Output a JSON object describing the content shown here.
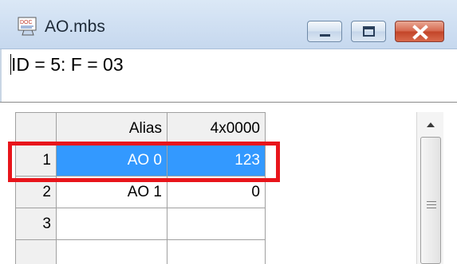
{
  "window": {
    "title": "AO.mbs",
    "icon": "doc-icon",
    "icon_label": "DOC",
    "controls": [
      "minimize",
      "maximize",
      "close"
    ]
  },
  "status": {
    "text": "ID = 5: F = 03"
  },
  "grid": {
    "columns": [
      "",
      "Alias",
      "4x0000"
    ],
    "rows": [
      {
        "row_num": "1",
        "alias": "AO 0",
        "value": "123",
        "selected": true
      },
      {
        "row_num": "2",
        "alias": "AO 1",
        "value": "0",
        "selected": false
      },
      {
        "row_num": "3",
        "alias": "",
        "value": "",
        "selected": false
      }
    ]
  },
  "colors": {
    "selection": "#3399ff",
    "highlight_box": "#e8151b"
  }
}
